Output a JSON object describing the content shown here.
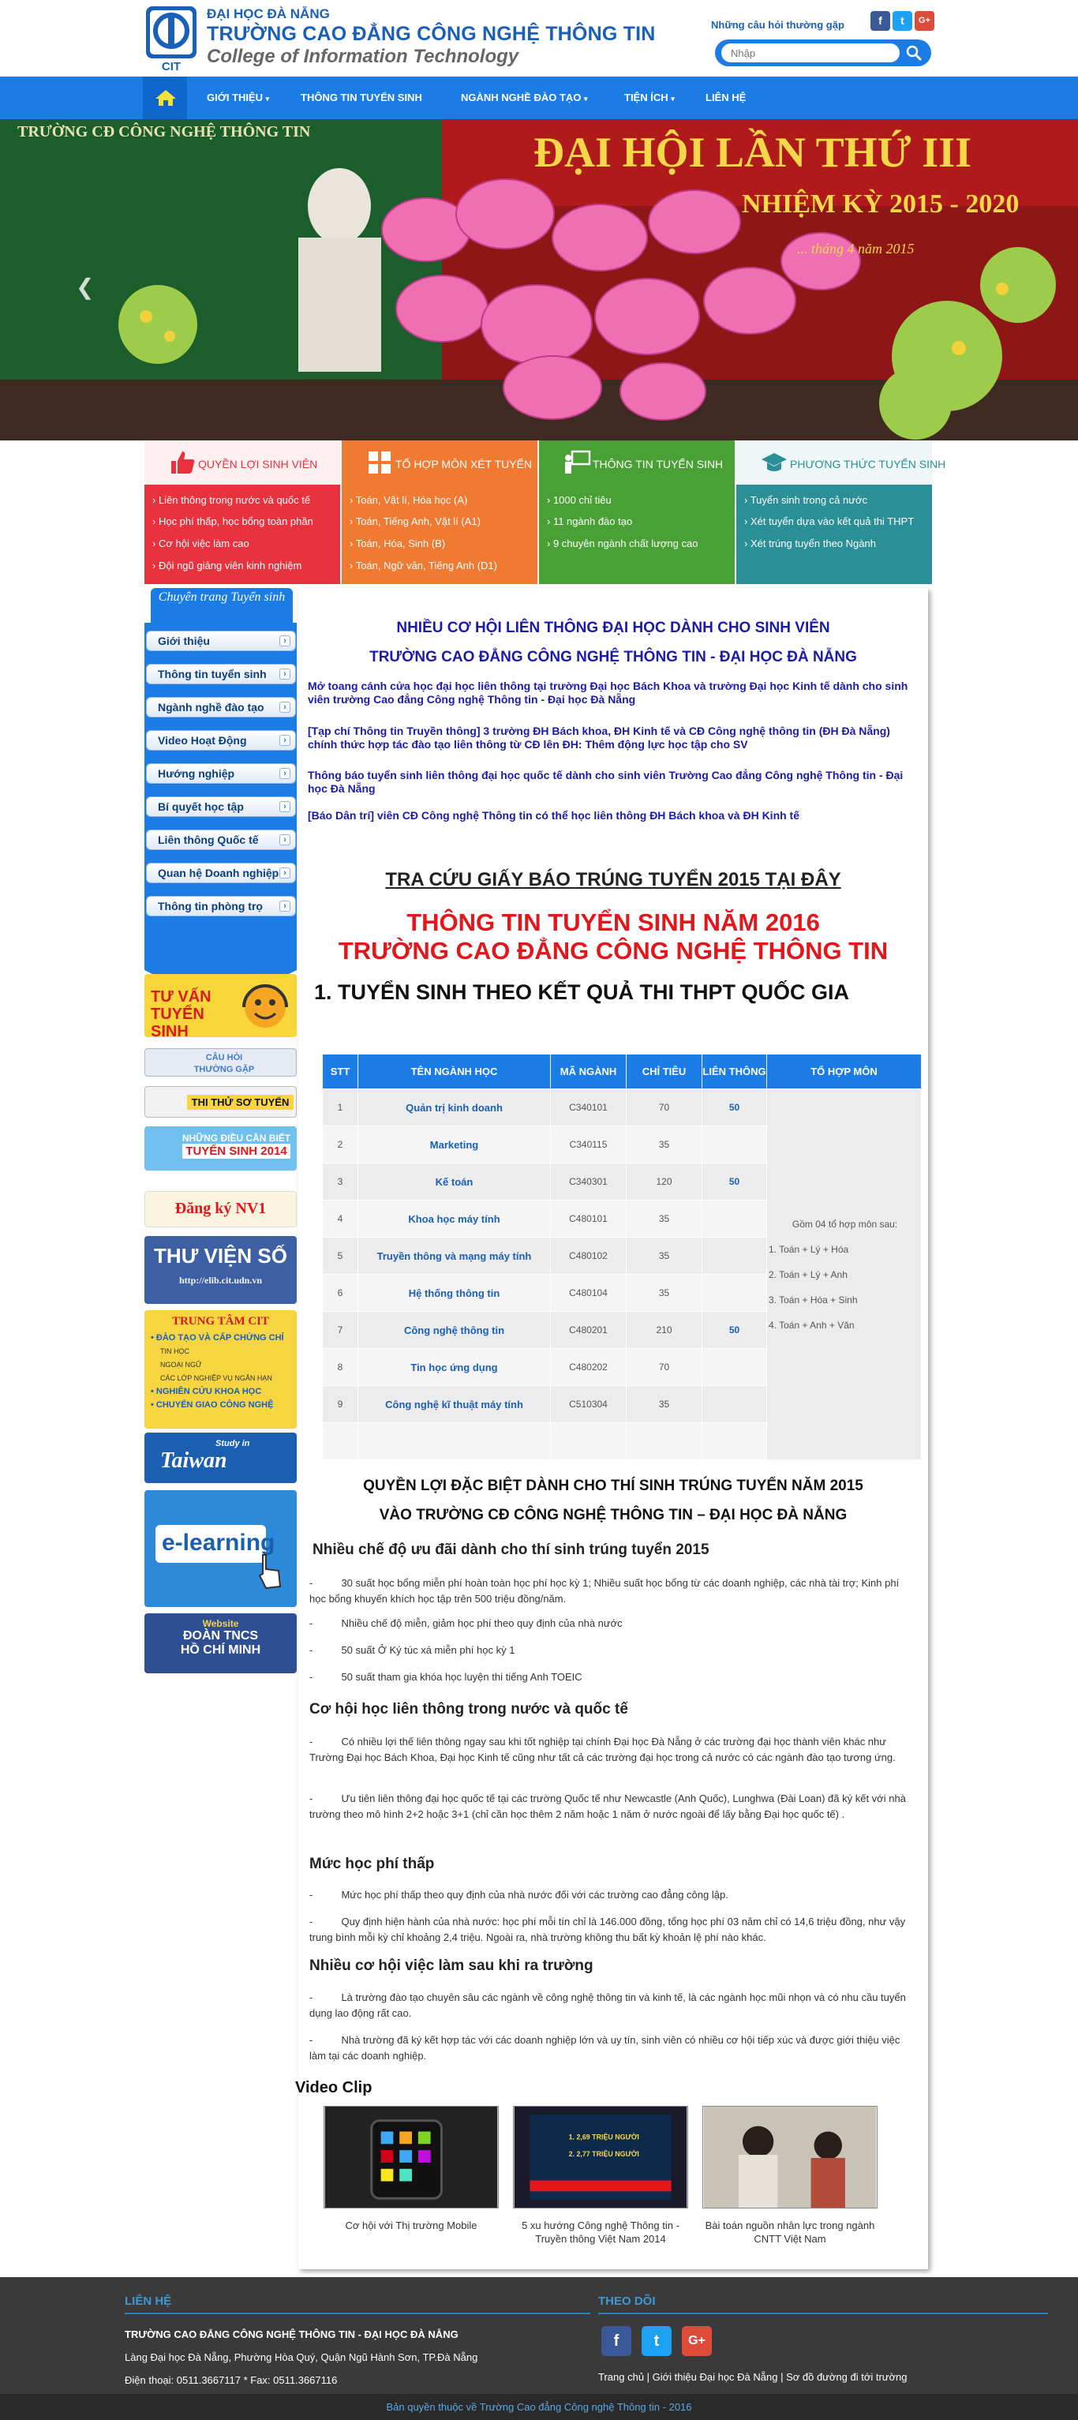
{
  "header": {
    "logo_text": "CIT",
    "org_top": "ĐẠI HỌC ĐÀ NẴNG",
    "org_main": "TRƯỜNG CAO ĐẲNG CÔNG NGHỆ THÔNG TIN",
    "org_sub": "College of Information Technology",
    "faq_link": "Những câu hỏi thường gặp",
    "search_placeholder": "Nhập",
    "social": [
      "f",
      "t",
      "G+"
    ]
  },
  "nav": {
    "items": [
      "GIỚI THIỆU",
      "THÔNG TIN TUYỂN SINH",
      "NGÀNH NGHỀ ĐÀO TẠO",
      "TIỆN ÍCH",
      "LIÊN HỆ"
    ]
  },
  "banner": {
    "school_tag": "TRƯỜNG CĐ CÔNG NGHỆ THÔNG TIN",
    "title": "ĐẠI HỘI LẦN THỨ III",
    "term": "NHIỆM KỲ 2015 - 2020",
    "date": "... tháng 4 năm 2015"
  },
  "features": [
    {
      "title": "QUYỀN LỢI SINH VIÊN",
      "color": "#e8333e",
      "lines": [
        "Liên thông trong nước và quốc tế",
        "Học phí thấp, học bổng toàn phần",
        "Cơ hội việc làm cao",
        "Đội ngũ giảng viên kinh nghiệm"
      ]
    },
    {
      "title": "TỔ HỢP MÔN XÉT TUYỂN",
      "color": "#f07a32",
      "lines": [
        "Toán, Vật lí, Hóa học (A)",
        "Toán, Tiếng Anh, Vật lí (A1)",
        "Toán, Hóa, Sinh (B)",
        "Toán, Ngữ văn, Tiếng Anh (D1)"
      ]
    },
    {
      "title": "THÔNG TIN TUYỂN SINH",
      "color": "#49a135",
      "lines": [
        "1000 chỉ tiêu",
        "11 ngành đào tạo",
        "9 chuyên ngành chất lượng cao"
      ]
    },
    {
      "title": "PHƯƠNG THỨC TUYỂN SINH",
      "color": "#2a8f96",
      "lines": [
        "Tuyển sinh trong cả nước",
        "Xét tuyển dựa vào kết quả thi THPT",
        "Xét trúng tuyển theo Ngành"
      ]
    }
  ],
  "sidebar": {
    "heading": "Chuyên trang Tuyển sinh",
    "items": [
      "Giới thiệu",
      "Thông tin tuyển sinh",
      "Ngành nghề đào tạo",
      "Video Hoạt Động",
      "Hướng nghiệp",
      "Bí quyết học tập",
      "Liên thông Quốc tế",
      "Quan hệ Doanh nghiệp",
      "Thông tin phòng trọ"
    ],
    "promos": {
      "tuvan": "TƯ VẤN TUYỂN SINH",
      "faq": "CÂU HỎI THƯỜNG GẶP",
      "thithu": "THI THỬ SƠ TUYỂN",
      "dieucanbiet_1": "NHỮNG ĐIỀU CẦN BIẾT",
      "dieucanbiet_2": "TUYỂN SINH 2014",
      "dangky": "Đăng ký NV1",
      "thuvien": "THƯ VIỆN SỐ",
      "thuvien_url": "http://elib.cit.udn.vn",
      "trungtam": "TRUNG TÂM CIT",
      "trungtam_lines": [
        "• ĐÀO TẠO VÀ CẤP CHỨNG CHỈ",
        "TIN HỌC",
        "NGOẠI NGỮ",
        "CÁC LỚP NGHIỆP VỤ NGẮN HẠN",
        "• NGHIÊN CỨU KHOA HỌC",
        "• CHUYỂN GIAO CÔNG NGHỆ"
      ],
      "taiwan_1": "Study in",
      "taiwan_2": "Taiwan",
      "elearning": "e-learning",
      "doan_1": "Website",
      "doan_2": "ĐOÀN TNCS",
      "doan_3": "HỒ CHÍ MINH"
    }
  },
  "main": {
    "heading_1": "NHIỀU CƠ HỘI LIÊN THÔNG ĐẠI HỌC DÀNH CHO SINH VIÊN",
    "heading_2": "TRƯỜNG CAO ĐẲNG CÔNG NGHỆ THÔNG TIN - ĐẠI HỌC ĐÀ NẴNG",
    "news": [
      "Mở toang cánh cửa học đại học liên thông tại trường Đại học Bách Khoa và trường Đại học Kinh tế dành cho sinh viên trường Cao đẳng Công nghệ Thông tin - Đại học Đà Nẵng",
      "[Tạp chí Thông tin Truyền thông] 3 trường ĐH Bách khoa, ĐH Kinh tế và CĐ Công nghệ thông tin (ĐH Đà Nẵng) chính thức hợp tác đào tạo liên thông từ CĐ lên ĐH: Thêm động lực học tập cho SV",
      "Thông báo tuyển sinh liên thông đại học quốc tế dành cho sinh viên Trường Cao đẳng Công nghệ Thông tin - Đại học Đà Nẵng",
      "[Báo Dân trí] viên CĐ Công nghệ Thông tin có thể học liên thông ĐH Bách khoa và ĐH Kinh tế"
    ],
    "tra_cuu": "TRA CỨU GIẤY BÁO TRÚNG TUYỂN 2015 TẠI ĐÂY",
    "red_title_1": "THÔNG TIN TUYỂN SINH NĂM 2016",
    "red_title_2": "TRƯỜNG CAO ĐẲNG CÔNG NGHỆ THÔNG TIN",
    "section_1": "1. TUYỂN SINH THEO KẾT QUẢ THI THPT QUỐC GIA",
    "table": {
      "headers": [
        "STT",
        "TÊN NGÀNH HỌC",
        "MÃ NGÀNH",
        "CHỈ TIÊU",
        "LIÊN THÔNG",
        "TỔ HỢP MÔN"
      ],
      "rows": [
        [
          "1",
          "Quản trị kinh doanh",
          "C340101",
          "70",
          "50"
        ],
        [
          "2",
          "Marketing",
          "C340115",
          "35",
          ""
        ],
        [
          "3",
          "Kế toán",
          "C340301",
          "120",
          "50"
        ],
        [
          "4",
          "Khoa học máy tính",
          "C480101",
          "35",
          ""
        ],
        [
          "5",
          "Truyền thông và mạng máy tính",
          "C480102",
          "35",
          ""
        ],
        [
          "6",
          "Hệ thống thông tin",
          "C480104",
          "35",
          ""
        ],
        [
          "7",
          "Công nghệ thông tin",
          "C480201",
          "210",
          "50"
        ],
        [
          "8",
          "Tin học ứng dụng",
          "C480202",
          "70",
          ""
        ],
        [
          "9",
          "Công nghệ kĩ thuật máy tính",
          "C510304",
          "35",
          ""
        ]
      ],
      "tohop_intro": "Gồm 04 tổ hợp môn sau:",
      "tohop": [
        "1. Toán + Lý + Hóa",
        "2. Toán + Lý + Anh",
        "3. Toán + Hóa + Sinh",
        "4. Toán + Anh + Văn"
      ]
    },
    "quyenloi_1": "QUYỀN LỢI ĐẶC BIỆT DÀNH CHO THÍ SINH TRÚNG TUYỂN NĂM 2015",
    "quyenloi_2": "VÀO TRƯỜNG CĐ CÔNG NGHỆ THÔNG TIN – ĐẠI HỌC ĐÀ NẴNG",
    "s1_title": "Nhiều chế độ ưu đãi dành cho thí sinh trúng tuyển 2015",
    "s1_items": [
      "30 suất học bổng miễn phí hoàn toàn học phí học kỳ 1; Nhiều suất học bổng từ các doanh nghiệp, các nhà tài trợ; Kinh phí học bổng khuyến khích học tập trên 500 triệu đồng/năm.",
      "Nhiều chế độ miễn, giảm học phí theo quy định của nhà nước",
      "50 suất Ở Ký túc xá miễn phí học kỳ 1",
      "50 suất tham gia khóa học luyện thi tiếng Anh TOEIC"
    ],
    "s2_title": "Cơ hội học liên thông trong nước và quốc tế",
    "s2_items": [
      "Có nhiều lợi thế liên thông ngay sau khi tốt nghiệp tại chính Đại học Đà Nẵng ở các trường đại học thành viên khác như Trường Đại học Bách Khoa, Đại học Kinh tế cũng như tất cả các trường đại học trong cả nước có các ngành đào tạo tương ứng.",
      "Ưu tiên liên thông đại học quốc tế tại các trường Quốc tế như Newcastle (Anh Quốc), Lunghwa (Đài Loan) đã ký kết với nhà trường theo mô hình 2+2 hoặc 3+1 (chỉ cần học thêm 2 năm hoặc 1 năm ở nước ngoài để lấy bằng Đại học quốc tế) ."
    ],
    "s3_title": "Mức học phí thấp",
    "s3_items": [
      "Mức học phí thấp theo quy định của nhà nước đối với các trường cao đẳng công lập.",
      "Quy định hiện hành của nhà nước: học phí mỗi tín chỉ là 146.000 đồng, tổng học phí 03 năm chỉ có 14,6 triệu đồng, như vậy trung bình mỗi kỳ chỉ khoảng 2,4 triệu. Ngoài ra, nhà trường không thu bất kỳ khoản lệ phí nào khác."
    ],
    "s4_title": "Nhiều cơ hội việc làm sau khi ra trường",
    "s4_items": [
      "Là trường đào tạo chuyên sâu các ngành về công nghệ thông tin và kinh tế, là các ngành học mũi nhọn và có nhu cầu tuyển dụng lao động rất cao.",
      "Nhà trường đã ký kết hợp tác với các doanh nghiệp lớn và uy tín, sinh viên có nhiều cơ hội tiếp xúc và được giới thiệu việc làm tại các doanh nghiệp."
    ],
    "video_title": "Video Clip",
    "videos": [
      {
        "caption": "Cơ hội với Thị trường Mobile"
      },
      {
        "caption": "5 xu hướng Công nghệ Thông tin - Truyền thông Việt Nam 2014"
      },
      {
        "caption": "Bài toán nguồn nhân lực trong ngành CNTT Việt Nam"
      }
    ],
    "video_overlay": [
      "1. 2,69 TRIỆU NGƯỜI",
      "2. 2,77 TRIỆU NGƯỜI"
    ]
  },
  "footer": {
    "contact_title": "LIÊN HỆ",
    "school": "TRƯỜNG CAO ĐẲNG CÔNG NGHỆ THÔNG TIN - ĐẠI HỌC ĐÀ NẴNG",
    "address": "Làng Đại học Đà Nẵng, Phường Hòa Quý, Quận Ngũ Hành Sơn, TP.Đà Nẵng",
    "phone": "Điện thoại: 0511.3667117 * Fax: 0511.3667116",
    "follow_title": "THEO DÕI",
    "links": "Trang chủ | Giới thiệu Đại học Đà Nẵng | Sơ đồ đường đi tới trường",
    "copyright": "Bản quyền thuộc về Trường Cao đẳng Công nghệ Thông tin - 2016"
  },
  "colors": {
    "primary": "#1a7ce4",
    "dark_blue": "#1b1bab",
    "red_title": "#e2161b",
    "footer_bg": "#3a3a3a"
  }
}
